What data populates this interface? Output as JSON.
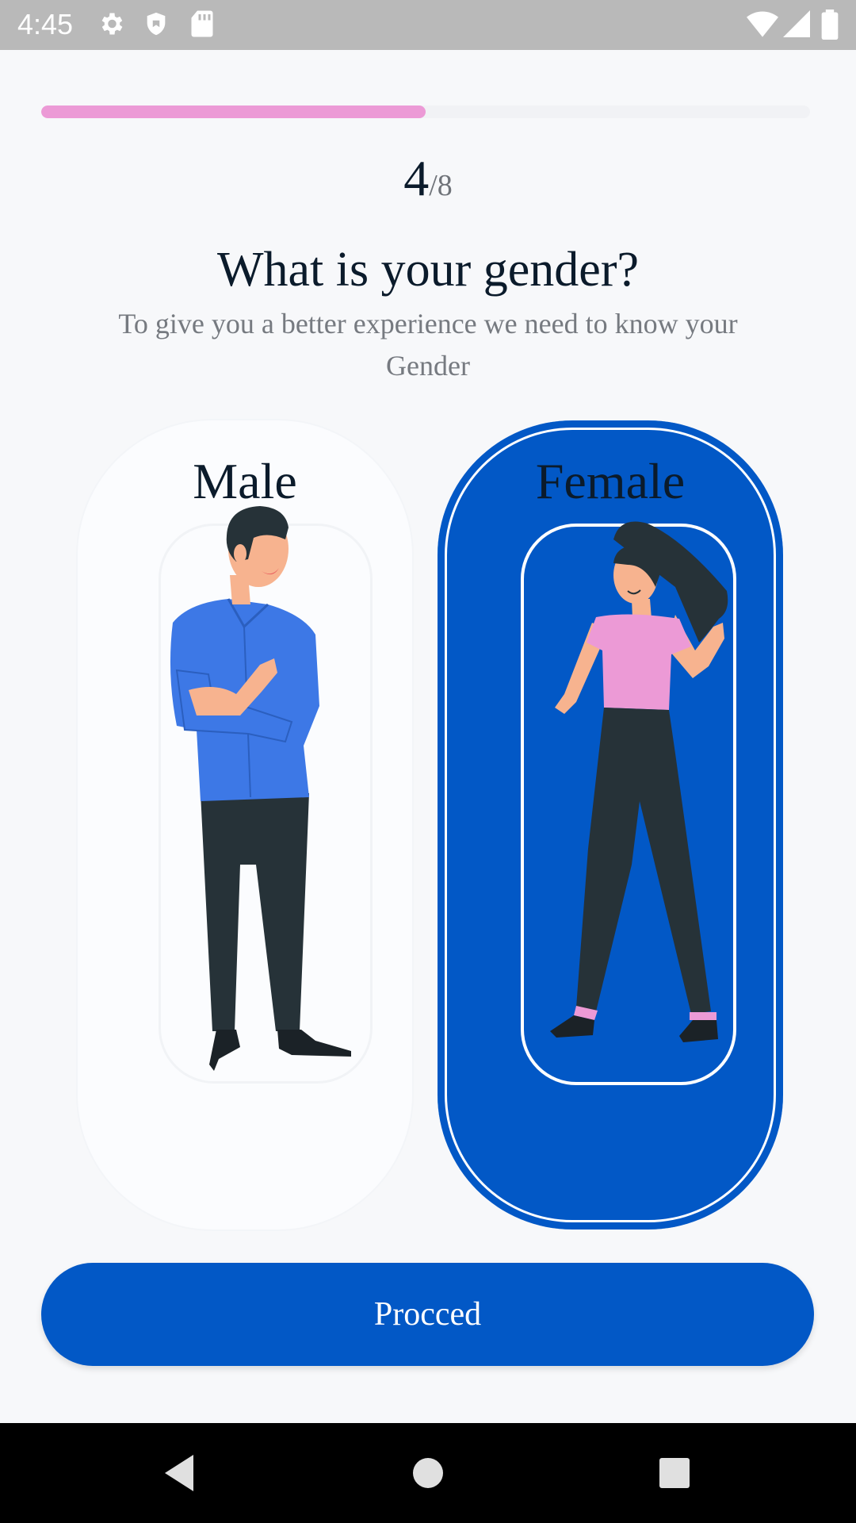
{
  "status_bar": {
    "time": "4:45",
    "icons": [
      "gear-icon",
      "shield-icon",
      "sd-card-icon",
      "wifi-icon",
      "signal-icon",
      "battery-icon"
    ]
  },
  "progress": {
    "fraction": 0.5,
    "current": "4",
    "total": "/8",
    "color": "#ec9ad6"
  },
  "header": {
    "title": "What is your gender?",
    "subtitle": "To give you a better experience we need to know your Gender"
  },
  "options": {
    "male": {
      "label": "Male",
      "selected": false
    },
    "female": {
      "label": "Female",
      "selected": true
    }
  },
  "actions": {
    "proceed_label": "Procced"
  },
  "colors": {
    "accent": "#0258c6",
    "progress": "#ec9ad6",
    "text": "#0b1b2b"
  },
  "nav_bar": {
    "icons": [
      "back-icon",
      "home-icon",
      "recents-icon"
    ]
  }
}
